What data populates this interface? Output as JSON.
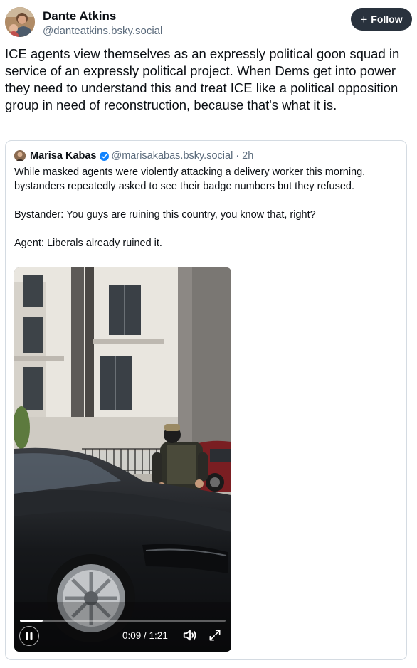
{
  "author": {
    "name": "Dante Atkins",
    "handle": "@danteatkins.bsky.social",
    "avatar_icon": "profile-photo"
  },
  "follow_button": {
    "label": "Follow",
    "icon": "plus-icon"
  },
  "post": {
    "text": "ICE agents view themselves as an expressly political goon squad in service of an expressly political project. When Dems get into power they need to understand this and treat ICE like a political opposition group in need of reconstruction, because that's what it is."
  },
  "quote": {
    "author_name": "Marisa Kabas",
    "verified": true,
    "handle": "@marisakabas.bsky.social",
    "separator": "·",
    "time": "2h",
    "paragraphs": [
      "While masked agents were violently attacking a delivery worker this morning, bystanders repeatedly asked to see their badge numbers but they refused.",
      "Bystander: You guys are ruining this country, you know that, right?",
      "Agent: Liberals already ruined it."
    ]
  },
  "video": {
    "current_time": "0:09",
    "duration": "1:21",
    "time_separator": " / ",
    "progress_fraction": 0.111,
    "playing": true,
    "colors": {
      "accent_verified": "#1083fe",
      "follow_bg": "#29323d"
    }
  }
}
